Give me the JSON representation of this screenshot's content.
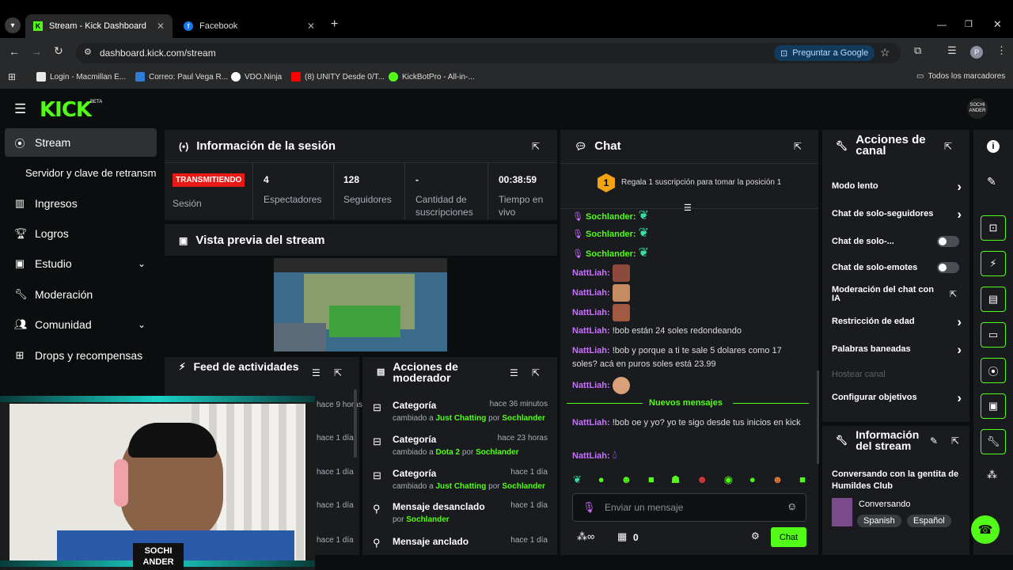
{
  "browser": {
    "tabs": [
      {
        "title": "Stream - Kick Dashboard",
        "active": true
      },
      {
        "title": "Facebook",
        "active": false
      }
    ],
    "url": "dashboard.kick.com/stream",
    "google_btn": "Preguntar a Google",
    "profile_initial": "P",
    "bookmarks": [
      {
        "label": "Login - Macmillan E...",
        "color": "#e8e8e8"
      },
      {
        "label": "Correo: Paul Vega R...",
        "color": "#2f7bd8"
      },
      {
        "label": "VDO.Ninja",
        "color": "#ffffff"
      },
      {
        "label": "(8) UNITY Desde 0/T...",
        "color": "#ff0000"
      },
      {
        "label": "KickBotPro - All-in-...",
        "color": "#53fc18"
      }
    ],
    "all_bookmarks": "Todos los marcadores"
  },
  "brand": {
    "logo": "KICK",
    "beta": "BETA",
    "accent": "#53fc18"
  },
  "sidebar": {
    "items": [
      {
        "label": "Stream",
        "icon": "broadcast-icon"
      },
      {
        "label": "Servidor y clave de retransm",
        "icon": ""
      },
      {
        "label": "Ingresos",
        "icon": "chart-icon"
      },
      {
        "label": "Logros",
        "icon": "trophy-icon"
      },
      {
        "label": "Estudio",
        "icon": "studio-icon"
      },
      {
        "label": "Moderación",
        "icon": "wrench-icon"
      },
      {
        "label": "Comunidad",
        "icon": "people-icon"
      },
      {
        "label": "Drops y recompensas",
        "icon": "drops-icon"
      }
    ]
  },
  "session": {
    "title": "Información de la sesión",
    "live_badge": "TRANSMITIENDO",
    "live_label": "Sesión",
    "stats": [
      {
        "value": "4",
        "label": "Espectadores"
      },
      {
        "value": "128",
        "label": "Seguidores"
      },
      {
        "value": "-",
        "label": "Cantidad de suscripciones"
      },
      {
        "value": "00:38:59",
        "label": "Tiempo en vivo"
      }
    ]
  },
  "preview": {
    "title": "Vista previa del stream"
  },
  "feed": {
    "title": "Feed de actividades",
    "times": [
      "hace 9 horas",
      "hace 1 día",
      "hace 1 día",
      "hace 1 día",
      "hace 1 día"
    ]
  },
  "mod_actions": {
    "title": "Acciones de moderador",
    "rows": [
      {
        "title": "Categoría",
        "time": "hace 36 minutos",
        "pre": "cambiado a",
        "target": "Just Chatting",
        "by": "por",
        "user": "Sochlander"
      },
      {
        "title": "Categoría",
        "time": "hace 23 horas",
        "pre": "cambiado a",
        "target": "Dota 2",
        "by": "por",
        "user": "Sochlander"
      },
      {
        "title": "Categoría",
        "time": "hace 1 día",
        "pre": "cambiado a",
        "target": "Just Chatting",
        "by": "por",
        "user": "Sochlander"
      },
      {
        "title": "Mensaje desanclado",
        "time": "hace 1 día",
        "pre": "",
        "target": "",
        "by": "por",
        "user": "Sochlander"
      },
      {
        "title": "Mensaje anclado",
        "time": "hace 1 día",
        "pre": "",
        "target": "",
        "by": "",
        "user": ""
      }
    ]
  },
  "chat": {
    "title": "Chat",
    "gift_rank": "1",
    "gift_text": "Regala 1 suscripción para tomar la posición 1",
    "messages": [
      {
        "nick": "Sochlander:",
        "text": "",
        "color": "green"
      },
      {
        "nick": "Sochlander:",
        "text": "",
        "color": "green"
      },
      {
        "nick": "Sochlander:",
        "text": "",
        "color": "green"
      },
      {
        "nick": "NattLiah:",
        "text": "",
        "color": "purple"
      },
      {
        "nick": "NattLiah:",
        "text": "",
        "color": "purple"
      },
      {
        "nick": "NattLiah:",
        "text": "",
        "color": "purple"
      },
      {
        "nick": "NattLiah:",
        "text": "!bob están 24 soles redondeando",
        "color": "purple"
      },
      {
        "nick": "NattLiah:",
        "text": "!bob y porque a ti te sale 5 dolares como 17 soles? acá en puros soles está 23.99",
        "color": "purple"
      },
      {
        "nick": "NattLiah:",
        "text": "",
        "color": "purple"
      }
    ],
    "new_messages": "Nuevos mensajes",
    "after": [
      {
        "nick": "NattLiah:",
        "text": "!bob oe y yo? yo te sigo desde tus inicios en kick"
      },
      {
        "nick": "NattLiah:",
        "text": ""
      }
    ],
    "input_placeholder": "Enviar un mensaje",
    "viewers_count": "0",
    "send_label": "Chat"
  },
  "channel_actions": {
    "title": "Acciones de canal",
    "rows": [
      {
        "label": "Modo lento",
        "control": "chevron"
      },
      {
        "label": "Chat de solo-seguidores",
        "control": "chevron"
      },
      {
        "label": "Chat de solo-...",
        "control": "toggle"
      },
      {
        "label": "Chat de solo-emotes",
        "control": "toggle"
      },
      {
        "label": "Moderación del chat con IA",
        "control": "external"
      },
      {
        "label": "Restricción de edad",
        "control": "chevron"
      },
      {
        "label": "Palabras baneadas",
        "control": "chevron"
      },
      {
        "label": "Hostear canal",
        "control": "disabled"
      },
      {
        "label": "Configurar objetivos",
        "control": "chevron"
      }
    ]
  },
  "stream_info": {
    "title": "Información del stream",
    "stream_title": "Conversando con la gentita de Humildes Club",
    "category": "Conversando",
    "tags": [
      "Spanish",
      "Español"
    ]
  },
  "webcam": {
    "overlay_text": "SOCHI ANDER"
  }
}
